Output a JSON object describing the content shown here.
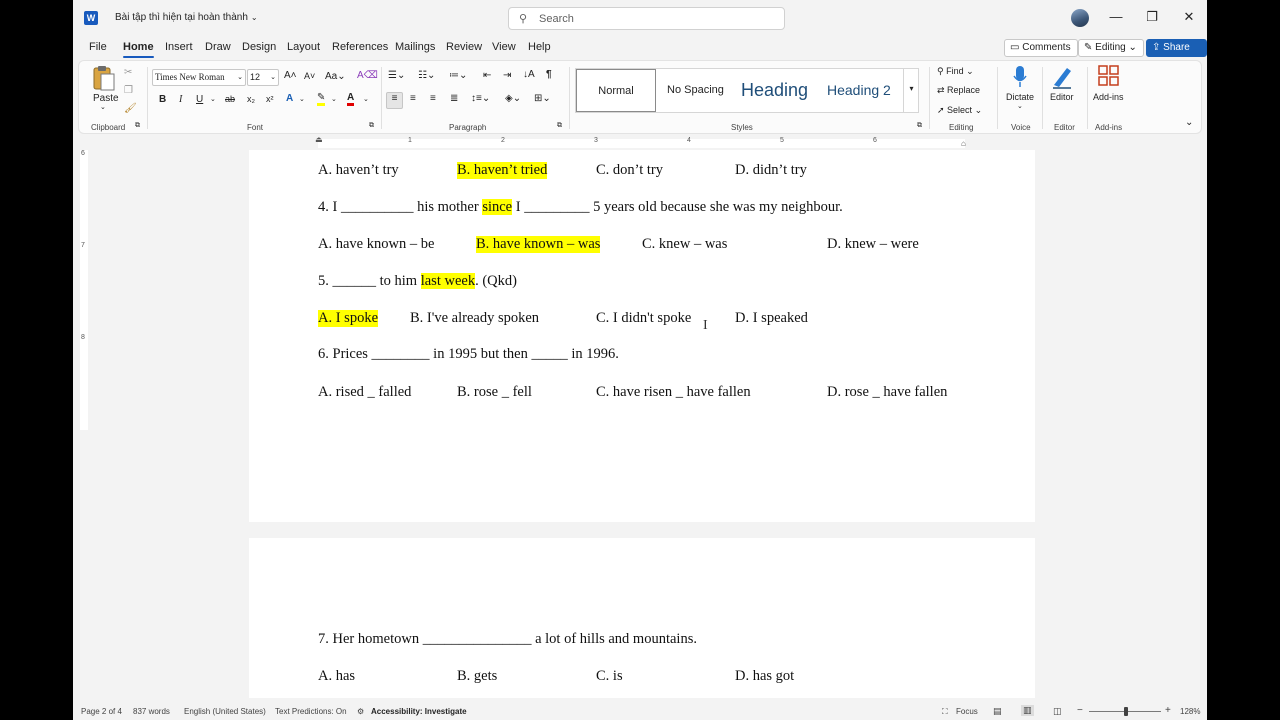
{
  "titlebar": {
    "app_logo": "W",
    "doc_title": "Bài tập thì hiện tại hoàn thành",
    "search_placeholder": "Search",
    "minimize": "—",
    "restore": "❐",
    "close": "✕"
  },
  "menu": {
    "tabs": [
      "File",
      "Home",
      "Insert",
      "Draw",
      "Design",
      "Layout",
      "References",
      "Mailings",
      "Review",
      "View",
      "Help"
    ],
    "active_tab": "Home",
    "comments": "Comments",
    "editing": "Editing",
    "share": "Share"
  },
  "ribbon": {
    "clipboard": {
      "paste": "Paste",
      "label": "Clipboard"
    },
    "font": {
      "name": "Times New Roman",
      "size": "12",
      "label": "Font",
      "font_color": "#e00000",
      "highlight_color": "#ffff00"
    },
    "paragraph": {
      "label": "Paragraph"
    },
    "styles": {
      "items": [
        "Normal",
        "No Spacing",
        "Heading",
        "Heading 2"
      ],
      "label": "Styles",
      "heading_color": "#1f4e79"
    },
    "editing": {
      "find": "Find",
      "replace": "Replace",
      "select": "Select",
      "label": "Editing"
    },
    "voice": {
      "dictate": "Dictate",
      "label": "Voice"
    },
    "editor": {
      "editor": "Editor",
      "label": "Editor"
    },
    "addins": {
      "addins": "Add-ins",
      "label": "Add-ins"
    }
  },
  "ruler": {
    "numbers": [
      "1",
      "2",
      "3",
      "4",
      "5",
      "6"
    ]
  },
  "vruler": {
    "numbers": [
      "6",
      "7",
      "8"
    ]
  },
  "document": {
    "page1": {
      "q3_options": [
        "A. haven’t try",
        "B. haven’t tried",
        "C. don’t try",
        "D. didn’t try"
      ],
      "q4": {
        "pre": "4. I __________ his mother ",
        "hl": "since",
        "post": " I _________ 5 years old because she was my neighbour."
      },
      "q4_options": [
        "A. have known – be",
        "B. have known – was",
        "C. knew – was",
        "D. knew – were"
      ],
      "q5": {
        "pre": "5. ______ to him ",
        "hl": "last week",
        "post": ". (Qkd)"
      },
      "q5_options": [
        "A. I spoke",
        "B. I've already spoken",
        "C. I didn't spoke",
        "D. I speaked"
      ],
      "q6": "6. Prices ________ in 1995 but then _____ in 1996.",
      "q6_options": [
        "A. rised _ falled",
        "B. rose _ fell",
        "C. have risen _ have fallen",
        "D. rose _ have fallen"
      ]
    },
    "page2": {
      "q7": "7. Her hometown _______________ a lot of hills and mountains.",
      "q7_options": [
        "A. has",
        "B. gets",
        "C. is",
        "D. has got"
      ]
    }
  },
  "status": {
    "page": "Page 2 of 4",
    "words": "837 words",
    "language": "English (United States)",
    "predictions": "Text Predictions: On",
    "accessibility": "Accessibility: Investigate",
    "focus": "Focus",
    "zoom": "128%"
  }
}
